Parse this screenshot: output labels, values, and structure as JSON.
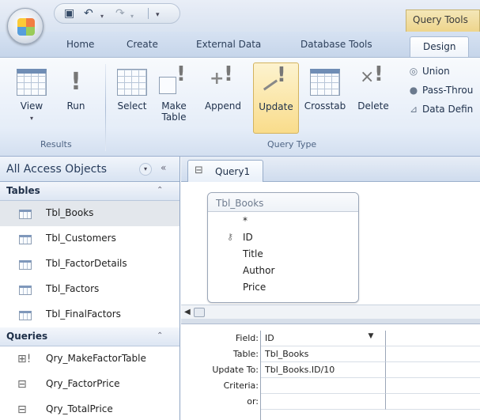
{
  "titlebar": {
    "context_label": "Query Tools"
  },
  "tabs": [
    {
      "label": "Home"
    },
    {
      "label": "Create"
    },
    {
      "label": "External Data"
    },
    {
      "label": "Database Tools"
    },
    {
      "label": "Design",
      "active": true
    }
  ],
  "ribbon": {
    "results": {
      "label": "Results",
      "view": "View",
      "run": "Run"
    },
    "query_type": {
      "label": "Query Type",
      "select": "Select",
      "make_table_1": "Make",
      "make_table_2": "Table",
      "append": "Append",
      "update": "Update",
      "crosstab": "Crosstab",
      "delete": "Delete",
      "union": "Union",
      "pass_through": "Pass-Throu",
      "data_definition": "Data Defin"
    }
  },
  "nav": {
    "title": "All Access Objects",
    "tables_label": "Tables",
    "tables": [
      "Tbl_Books",
      "Tbl_Customers",
      "Tbl_FactorDetails",
      "Tbl_Factors",
      "Tbl_FinalFactors"
    ],
    "selected_table": "Tbl_Books",
    "queries_label": "Queries",
    "queries": [
      "Qry_MakeFactorTable",
      "Qry_FactorPrice",
      "Qry_TotalPrice"
    ]
  },
  "document": {
    "tab_label": "Query1",
    "field_list": {
      "title": "Tbl_Books",
      "fields": [
        "*",
        "ID",
        "Title",
        "Author",
        "Price"
      ],
      "key_field": "ID"
    },
    "grid": {
      "row_labels": [
        "Field:",
        "Table:",
        "Update To:",
        "Criteria:",
        "or:"
      ],
      "column1": {
        "field": "ID",
        "table": "Tbl_Books",
        "update_to": "Tbl_Books.ID/10",
        "criteria": "",
        "or": ""
      }
    }
  },
  "colors": {
    "ribbon_bg": "#e5edf8",
    "selected_button": "#f9dc8b",
    "context_tab": "#eed58c",
    "nav_selected": "#e3e7ec"
  }
}
